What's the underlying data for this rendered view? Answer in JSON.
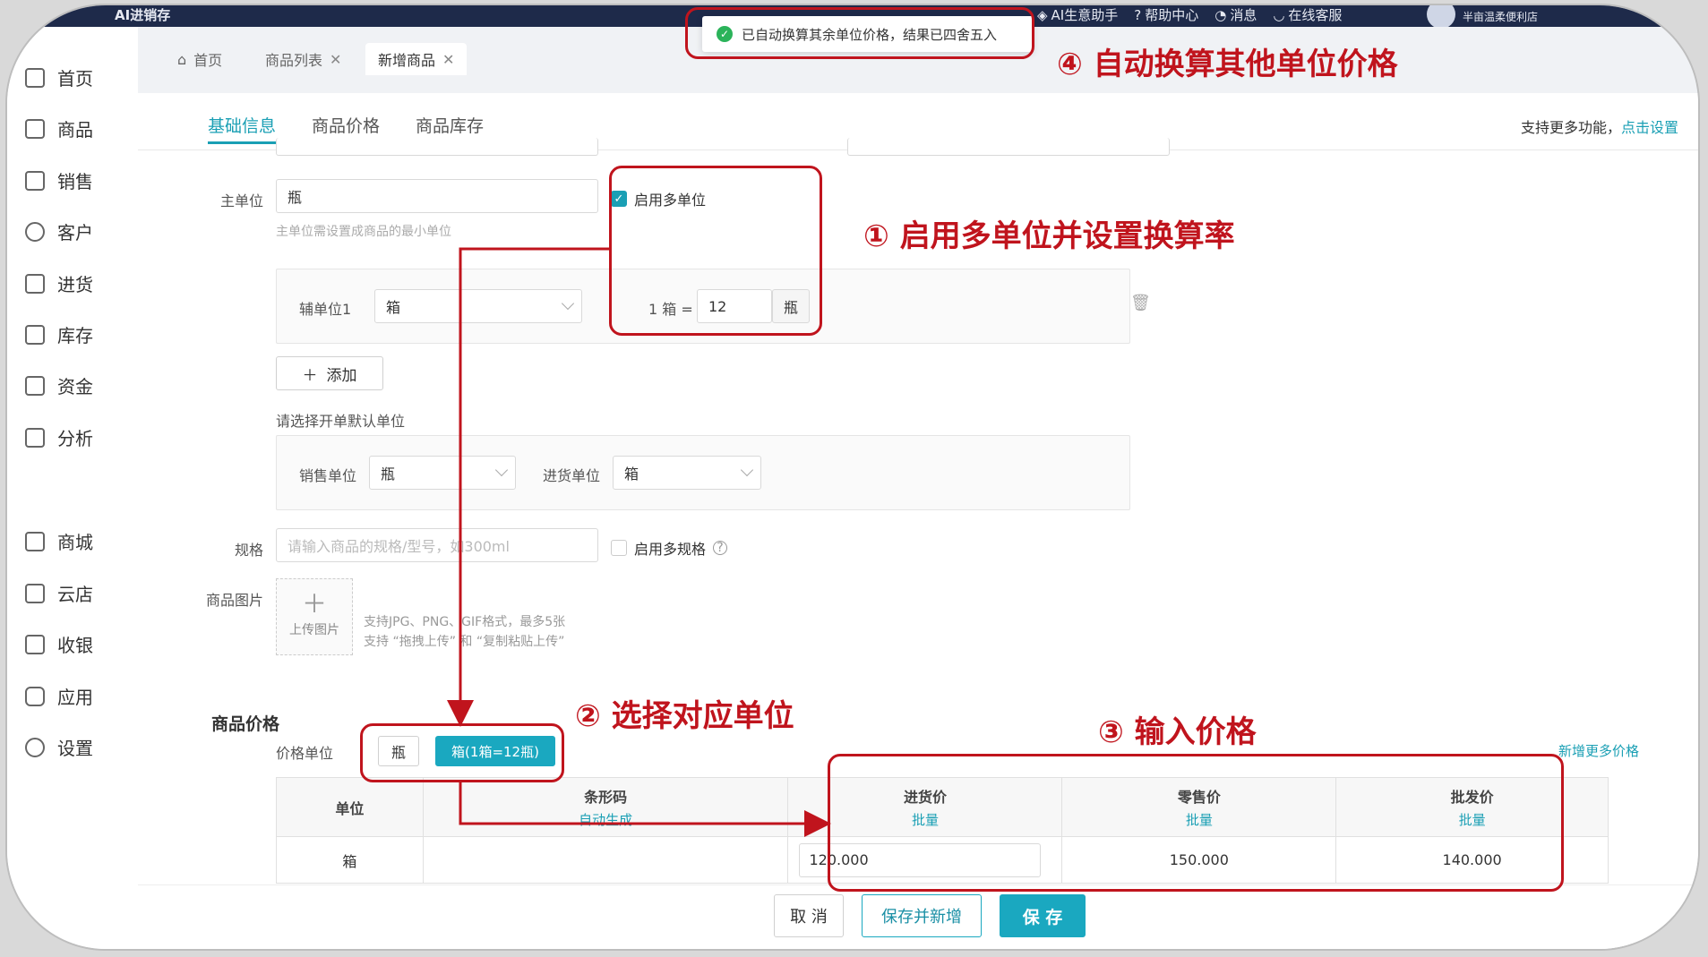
{
  "topbar": {
    "app_title": "AI进销存",
    "links": [
      "AI生意助手",
      "帮助中心",
      "消息",
      "在线客服"
    ],
    "shop_name": "半亩温柔便利店"
  },
  "sidebar": {
    "items": [
      {
        "label": "首页",
        "icon": "home-icon"
      },
      {
        "label": "商品",
        "icon": "product-icon"
      },
      {
        "label": "销售",
        "icon": "sales-icon"
      },
      {
        "label": "客户",
        "icon": "customer-icon"
      },
      {
        "label": "进货",
        "icon": "purchase-icon"
      },
      {
        "label": "库存",
        "icon": "inventory-icon"
      },
      {
        "label": "资金",
        "icon": "funds-icon"
      },
      {
        "label": "分析",
        "icon": "analysis-icon"
      },
      {
        "label": "商城",
        "icon": "mall-icon"
      },
      {
        "label": "云店",
        "icon": "cloud-store-icon"
      },
      {
        "label": "收银",
        "icon": "cashier-icon"
      },
      {
        "label": "应用",
        "icon": "apps-icon"
      },
      {
        "label": "设置",
        "icon": "settings-icon"
      }
    ]
  },
  "tabs": [
    "首页",
    "商品列表",
    "新增商品"
  ],
  "subtabs": [
    "基础信息",
    "商品价格",
    "商品库存"
  ],
  "more_note": {
    "text": "支持更多功能，",
    "link": "点击设置"
  },
  "form": {
    "main_unit_label": "主单位",
    "main_unit_value": "瓶",
    "main_unit_hint": "主单位需设置成商品的最小单位",
    "multi_unit_label": "启用多单位",
    "aux_unit_label": "辅单位1",
    "aux_unit_value": "箱",
    "conversion_prefix": "1 箱 =",
    "conversion_value": "12",
    "conversion_unit": "瓶",
    "add_label": "添加",
    "default_unit_title": "请选择开单默认单位",
    "sales_unit_label": "销售单位",
    "sales_unit_value": "瓶",
    "purchase_unit_label": "进货单位",
    "purchase_unit_value": "箱",
    "spec_label": "规格",
    "spec_placeholder": "请输入商品的规格/型号，如300ml",
    "multi_spec_label": "启用多规格",
    "image_label": "商品图片",
    "upload_label": "上传图片",
    "upload_hint_1": "支持JPG、PNG、GIF格式，最多5张",
    "upload_hint_2": "支持 “拖拽上传” 和 “复制粘贴上传”"
  },
  "prices": {
    "section_title": "商品价格",
    "price_unit_label": "价格单位",
    "unit_options": [
      "瓶",
      "箱(1箱=12瓶)"
    ],
    "selected_unit": "箱(1箱=12瓶)",
    "add_more_link": "新增更多价格",
    "headers": {
      "unit": "单位",
      "barcode": "条形码",
      "barcode_sub": "自动生成",
      "purchase": "进货价",
      "retail": "零售价",
      "wholesale": "批发价",
      "batch": "批量"
    },
    "row": {
      "unit": "箱",
      "barcode": "",
      "purchase": "120.000",
      "retail": "150.000",
      "wholesale": "140.000"
    }
  },
  "footer": {
    "cancel": "取 消",
    "save_new": "保存并新增",
    "save": "保 存"
  },
  "toast": "已自动换算其余单位价格，结果已四舍五入",
  "annotations": {
    "step1": "① 启用多单位并设置换算率",
    "step2": "② 选择对应单位",
    "step3": "③ 输入价格",
    "step4": "④ 自动换算其他单位价格"
  },
  "colors": {
    "accent": "#1a9fb4",
    "annotation": "#c0141d",
    "topbar": "#1e2a4a"
  }
}
